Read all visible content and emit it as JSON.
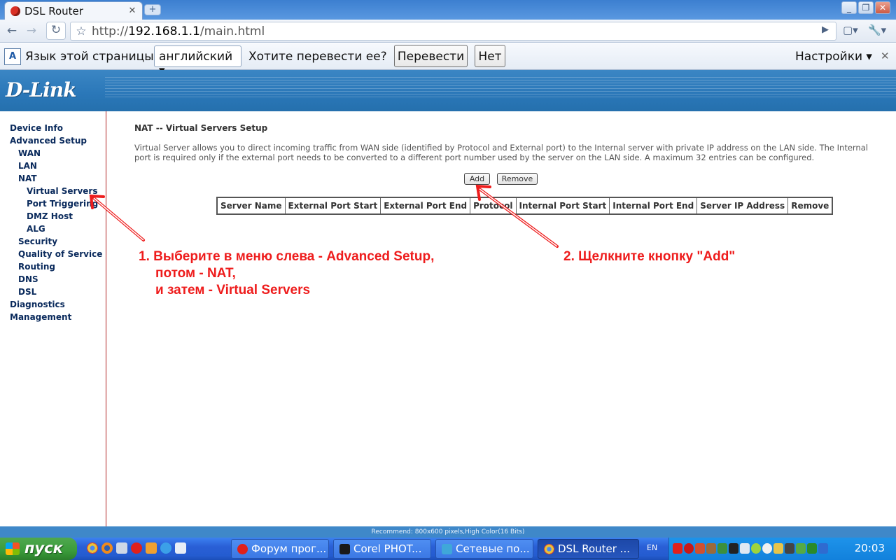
{
  "browser": {
    "tab_title": "DSL Router",
    "url_prefix": "http://",
    "url_host": "192.168.1.1",
    "url_path": "/main.html"
  },
  "translate_bar": {
    "label": "Язык этой страницы",
    "language": "английский",
    "question": "Хотите перевести ее?",
    "translate_button": "Перевести",
    "no_button": "Нет",
    "settings": "Настройки"
  },
  "router": {
    "logo": "D-Link",
    "menu": [
      {
        "label": "Device Info",
        "level": 0
      },
      {
        "label": "Advanced Setup",
        "level": 0
      },
      {
        "label": "WAN",
        "level": 1
      },
      {
        "label": "LAN",
        "level": 1
      },
      {
        "label": "NAT",
        "level": 1
      },
      {
        "label": "Virtual Servers",
        "level": 2
      },
      {
        "label": "Port Triggering",
        "level": 2
      },
      {
        "label": "DMZ Host",
        "level": 2
      },
      {
        "label": "ALG",
        "level": 2
      },
      {
        "label": "Security",
        "level": 1
      },
      {
        "label": "Quality of Service",
        "level": 1
      },
      {
        "label": "Routing",
        "level": 1
      },
      {
        "label": "DNS",
        "level": 1
      },
      {
        "label": "DSL",
        "level": 1
      },
      {
        "label": "Diagnostics",
        "level": 0
      },
      {
        "label": "Management",
        "level": 0
      }
    ],
    "title": "NAT -- Virtual Servers Setup",
    "description": "Virtual Server allows you to direct incoming traffic from WAN side (identified by Protocol and External port) to the Internal server with private IP address on the LAN side. The Internal port is required only if the external port needs to be converted to a different port number used by the server on the LAN side. A maximum 32 entries can be configured.",
    "add_button": "Add",
    "remove_button": "Remove",
    "table_headers": [
      "Server Name",
      "External Port Start",
      "External Port End",
      "Protocol",
      "Internal Port Start",
      "Internal Port End",
      "Server IP Address",
      "Remove"
    ],
    "status_bar": "Recommend: 800x600 pixels,High Color(16 Bits)"
  },
  "annotations": {
    "step1_line1": "1. Выберите в меню слева - Advanced Setup,",
    "step1_line2": "потом - NAT,",
    "step1_line3": "и затем - Virtual Servers",
    "step2": "2. Щелкните кнопку \"Add\"",
    "color": "#ee1c1c"
  },
  "taskbar": {
    "start": "пуск",
    "buttons": [
      "Форум прог...",
      "Corel PHOT...",
      "Сетевые по...",
      "DSL Router ..."
    ],
    "language": "EN",
    "clock": "20:03"
  }
}
